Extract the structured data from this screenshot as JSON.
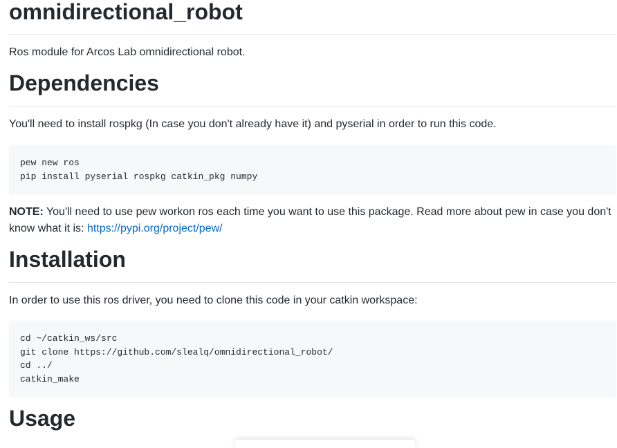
{
  "readme": {
    "title": "omnidirectional_robot",
    "description": "Ros module for Arcos Lab omnidirectional robot.",
    "dependencies": {
      "heading": "Dependencies",
      "text": "You'll need to install rospkg (In case you don't already have it) and pyserial in order to run this code.",
      "code": [
        "pew new ros",
        "pip install pyserial rospkg catkin_pkg numpy"
      ],
      "note_label": "NOTE:",
      "note_text": " You'll need to use pew workon ros each time you want to use this package. Read more about pew in case you don't know what it is: ",
      "note_link": "https://pypi.org/project/pew/"
    },
    "installation": {
      "heading": "Installation",
      "text": "In order to use this ros driver, you need to clone this code in your catkin workspace:",
      "code": [
        "cd ~/catkin_ws/src",
        "git clone https://github.com/slealq/omnidirectional_robot/",
        "cd ../",
        "catkin_make"
      ]
    },
    "usage": {
      "heading": "Usage"
    }
  }
}
